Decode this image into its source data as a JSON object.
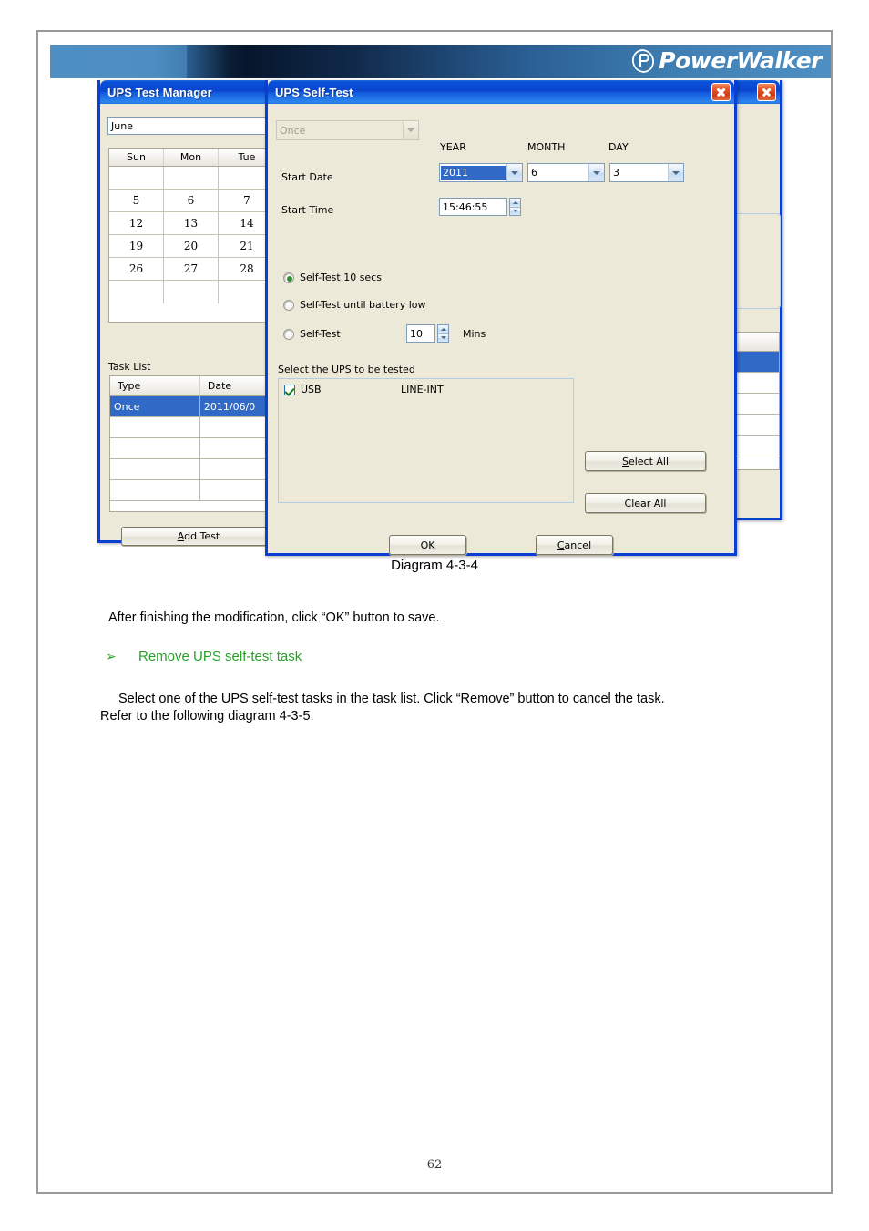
{
  "banner": {
    "brand": "PowerWalker",
    "logo_icon": "powerwalker-logo-icon"
  },
  "test_manager": {
    "title": "UPS Test Manager",
    "close_label": "x",
    "month_field": "June",
    "calendar": {
      "headers": [
        "Sun",
        "Mon",
        "Tue"
      ],
      "rows": [
        [
          "",
          "",
          ""
        ],
        [
          "5",
          "6",
          "7"
        ],
        [
          "12",
          "13",
          "14"
        ],
        [
          "19",
          "20",
          "21"
        ],
        [
          "26",
          "27",
          "28"
        ],
        [
          "",
          "",
          ""
        ]
      ]
    },
    "task_list_label": "Task List",
    "task_headers": [
      "Type",
      "Date"
    ],
    "task_rows": [
      {
        "type": "Once",
        "date": "2011/06/0",
        "selected": true
      },
      {
        "type": "",
        "date": "",
        "selected": false
      },
      {
        "type": "",
        "date": "",
        "selected": false
      },
      {
        "type": "",
        "date": "",
        "selected": false
      },
      {
        "type": "",
        "date": "",
        "selected": false
      }
    ],
    "add_test_label_pre": "",
    "add_test_accel": "A",
    "add_test_label_post": "dd Test"
  },
  "self_test": {
    "title": "UPS Self-Test",
    "close_label": "x",
    "frequency_value": "Once",
    "frequency_disabled": true,
    "col_year": "YEAR",
    "col_month": "MONTH",
    "col_day": "DAY",
    "start_date_label": "Start Date",
    "year_value": "2011",
    "month_value": "6",
    "day_value": "3",
    "start_time_label": "Start Time",
    "start_time_value": "15:46:55",
    "radio_10secs": "Self-Test 10 secs",
    "radio_until_low": "Self-Test until battery low",
    "radio_mins_label": "Self-Test",
    "mins_value": "10",
    "mins_unit": "Mins",
    "selected_radio": 0,
    "select_ups_label": "Select the UPS to be tested",
    "ups_rows": [
      {
        "name": "USB",
        "type": "LINE-INT",
        "checked": true
      }
    ],
    "select_all_accel": "S",
    "select_all_rest": "elect All",
    "clear_all_label": "Clear All",
    "ok_label": "OK",
    "cancel_accel": "C",
    "cancel_rest": "ancel"
  },
  "document": {
    "caption": "Diagram 4-3-4",
    "para1": "After finishing the modification, click “OK” button to save.",
    "bullet_glyph": "➢",
    "heading": "Remove UPS self-test task",
    "para2_line1": "Select one of the UPS self-test tasks in the task list. Click “Remove” button to cancel the task.",
    "para2_line2": "Refer to the following diagram 4-3-5.",
    "page_number": "62"
  },
  "colors": {
    "accent_blue": "#0a3fd4",
    "title_blue": "#0a4fd8",
    "dialog_face": "#ece9d8",
    "selection_blue": "#3169c6",
    "heading_green": "#2aa02a",
    "radio_green": "#2f8f2f",
    "close_red": "#cf3a13"
  }
}
